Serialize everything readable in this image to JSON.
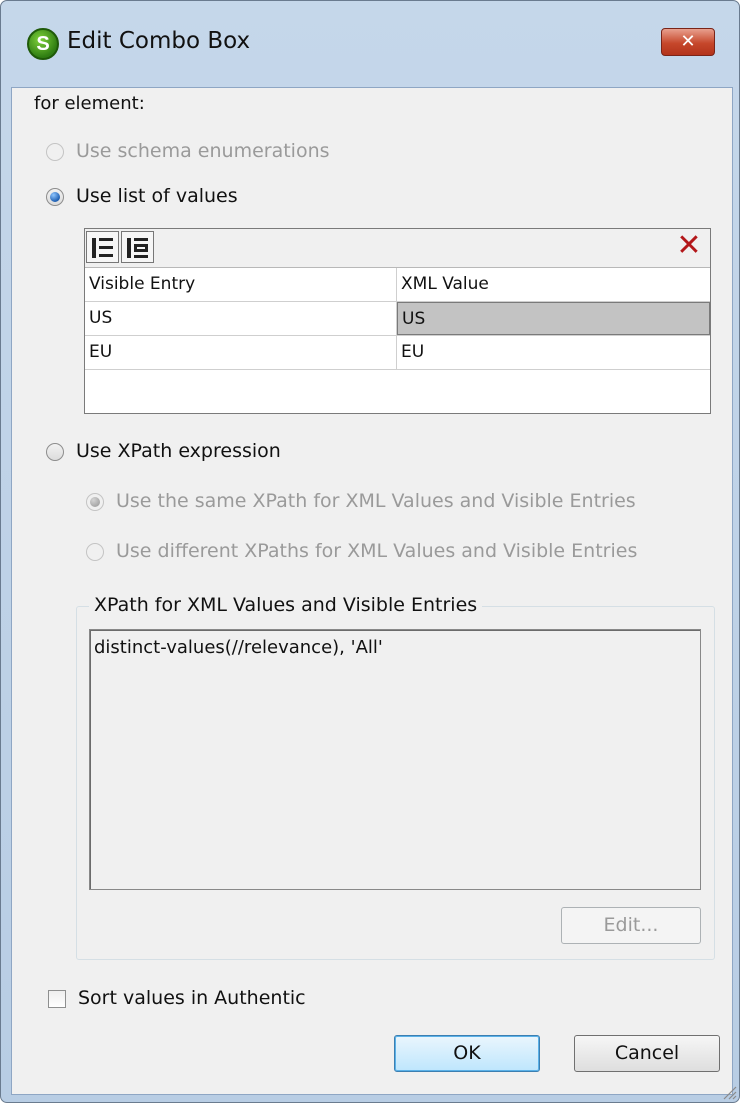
{
  "window": {
    "title": "Edit Combo Box",
    "close_symbol": "✕"
  },
  "labels": {
    "for_element": "for element:"
  },
  "options": {
    "schema_enum": "Use schema enumerations",
    "list_values": "Use list of values",
    "xpath_expr": "Use XPath expression",
    "same_xpath": "Use the same XPath for XML Values and Visible Entries",
    "diff_xpath": "Use different XPaths for XML Values and Visible Entries"
  },
  "grid": {
    "headers": [
      "Visible Entry",
      "XML Value"
    ],
    "rows": [
      {
        "visible": "US",
        "xml": "US"
      },
      {
        "visible": "EU",
        "xml": "EU"
      }
    ],
    "delete_symbol": "✕"
  },
  "xpath_group": {
    "legend": "XPath for XML Values and Visible Entries",
    "expression": "distinct-values(//relevance), 'All'",
    "edit_label": "Edit..."
  },
  "sort": {
    "label": "Sort values in Authentic",
    "checked": false
  },
  "buttons": {
    "ok": "OK",
    "cancel": "Cancel"
  },
  "icons": {
    "app": "s-logo-icon",
    "grid_insert_before": "insert-row-icon",
    "grid_append": "append-row-icon",
    "grid_delete": "delete-row-icon"
  }
}
